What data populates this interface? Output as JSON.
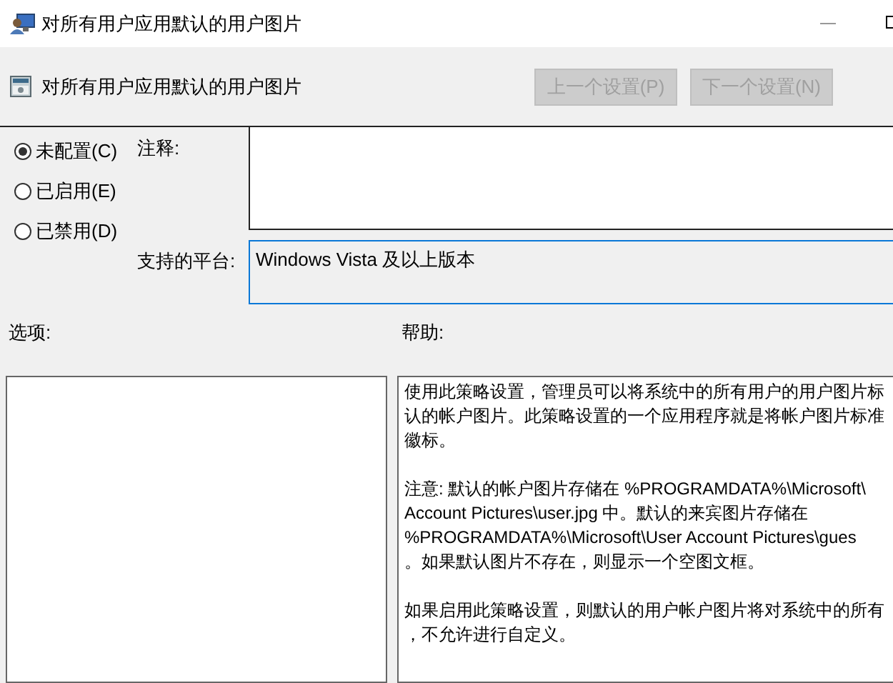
{
  "window": {
    "title": "对所有用户应用默认的用户图片"
  },
  "header": {
    "title": "对所有用户应用默认的用户图片",
    "buttons": [
      {
        "label": "上一个设置(P)",
        "disabled": true
      },
      {
        "label": "下一个设置(N)",
        "disabled": true
      }
    ]
  },
  "state_options": [
    {
      "label": "未配置(C)",
      "selected": true
    },
    {
      "label": "已启用(E)",
      "selected": false
    },
    {
      "label": "已禁用(D)",
      "selected": false
    }
  ],
  "comment": {
    "label": "注释:"
  },
  "supported_on": {
    "label": "支持的平台:",
    "value": "Windows Vista 及以上版本"
  },
  "options": {
    "label": "选项:"
  },
  "help": {
    "label": "帮助:",
    "paragraphs": [
      [
        "使用此策略设置，管理员可以将系统中的所有用户的用户图片标",
        "认的帐户图片。此策略设置的一个应用程序就是将帐户图片标准",
        "徽标。"
      ],
      [
        "注意: 默认的帐户图片存储在 %PROGRAMDATA%\\Microsoft\\",
        "Account Pictures\\user.jpg 中。默认的来宾图片存储在",
        "%PROGRAMDATA%\\Microsoft\\User Account Pictures\\gues",
        "。如果默认图片不存在，则显示一个空图文框。"
      ],
      [
        "如果启用此策略设置，则默认的用户帐户图片将对系统中的所有",
        "，不允许进行自定义。"
      ]
    ]
  }
}
